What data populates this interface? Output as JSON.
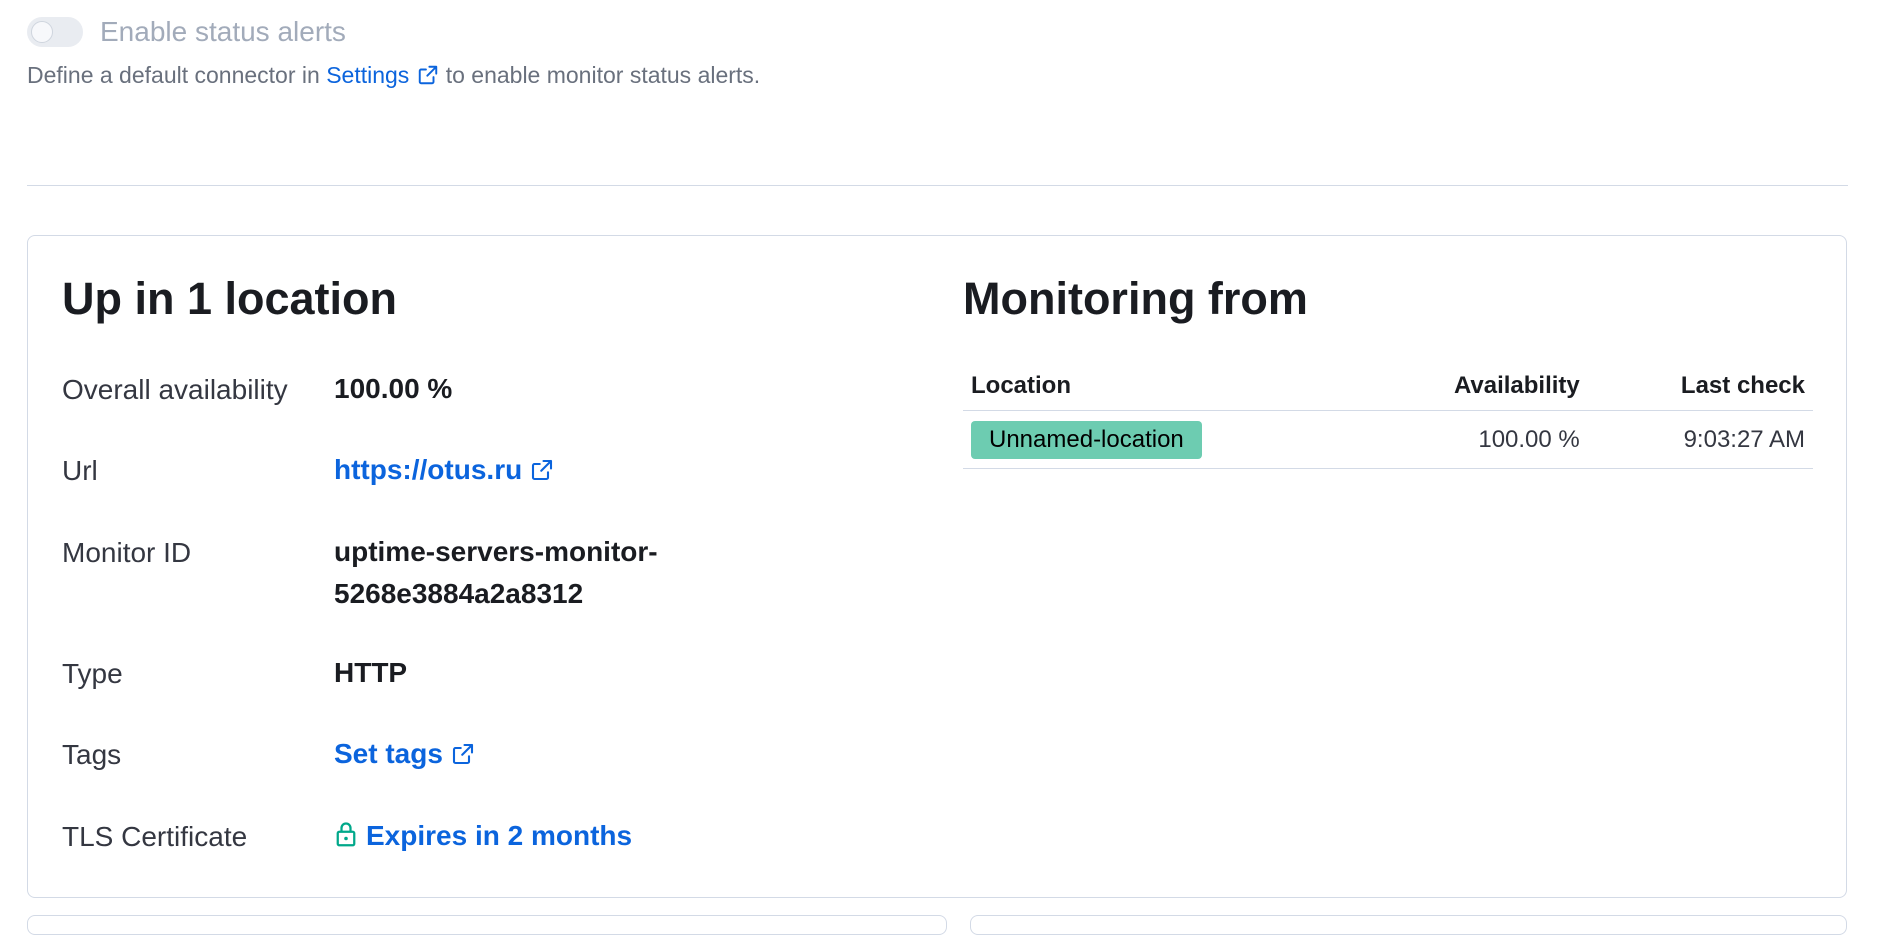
{
  "alerts": {
    "toggle_label": "Enable status alerts",
    "toggle_on": false,
    "help_before": "Define a default connector in ",
    "help_link": "Settings",
    "help_after": " to enable monitor status alerts."
  },
  "status": {
    "title": "Up in 1 location",
    "properties": {
      "availability": {
        "label": "Overall availability",
        "value": "100.00 %"
      },
      "url": {
        "label": "Url",
        "value": "https://otus.ru"
      },
      "monitor_id": {
        "label": "Monitor ID",
        "value": "uptime-servers-monitor-5268e3884a2a8312"
      },
      "type": {
        "label": "Type",
        "value": "HTTP"
      },
      "tags": {
        "label": "Tags",
        "value": "Set tags"
      },
      "tls": {
        "label": "TLS Certificate",
        "value": "Expires in 2 months"
      }
    }
  },
  "monitoring": {
    "title": "Monitoring from",
    "columns": {
      "location": "Location",
      "availability": "Availability",
      "last_check": "Last check"
    },
    "rows": [
      {
        "location": "Unnamed-location",
        "availability": "100.00 %",
        "last_check": "9:03:27 AM"
      }
    ]
  },
  "colors": {
    "link": "#0b64dd",
    "location_badge": "#6dccb1",
    "tls_lock": "#00a88a"
  },
  "icons": {
    "external_link": "external-link-icon",
    "lock": "lock-icon"
  }
}
